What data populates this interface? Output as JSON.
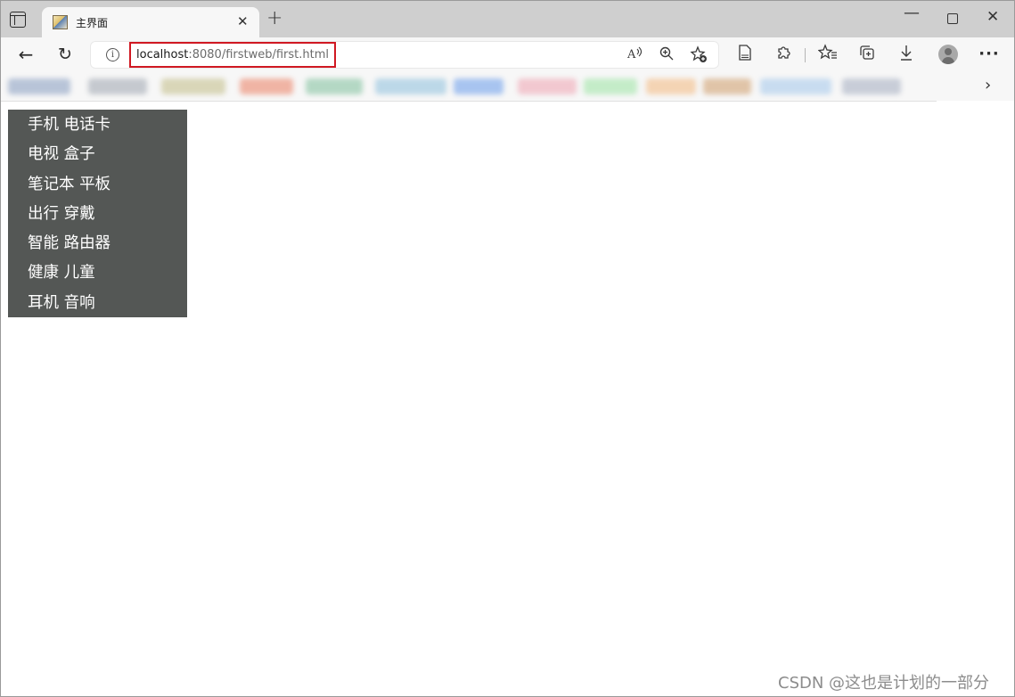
{
  "browser": {
    "tab": {
      "title": "主界面",
      "close_glyph": "✕"
    },
    "new_tab_glyph": "+",
    "window_controls": {
      "minimize": "—",
      "close": "✕"
    },
    "toolbar": {
      "back_glyph": "←",
      "refresh_glyph": "↻",
      "more_glyph": "···",
      "favbar_chevron": "›"
    },
    "address": {
      "host": "localhost",
      "rest": ":8080/firstweb/first.html",
      "info_glyph": "i",
      "highlight_color": "#d01822"
    },
    "icons": [
      "sidebar-toggle-icon",
      "back-icon",
      "refresh-icon",
      "info-icon",
      "read-aloud-icon",
      "zoom-icon",
      "add-favorite-icon",
      "page-icon",
      "extensions-icon",
      "favorites-icon",
      "collections-icon",
      "download-icon",
      "profile-avatar",
      "more-icon"
    ]
  },
  "page": {
    "menu_bg": "#545755",
    "menu_items": [
      "手机 电话卡",
      "电视 盒子",
      "笔记本 平板",
      "出行 穿戴",
      "智能 路由器",
      "健康 儿童",
      "耳机 音响"
    ]
  },
  "watermark": "CSDN @这也是计划的一部分"
}
